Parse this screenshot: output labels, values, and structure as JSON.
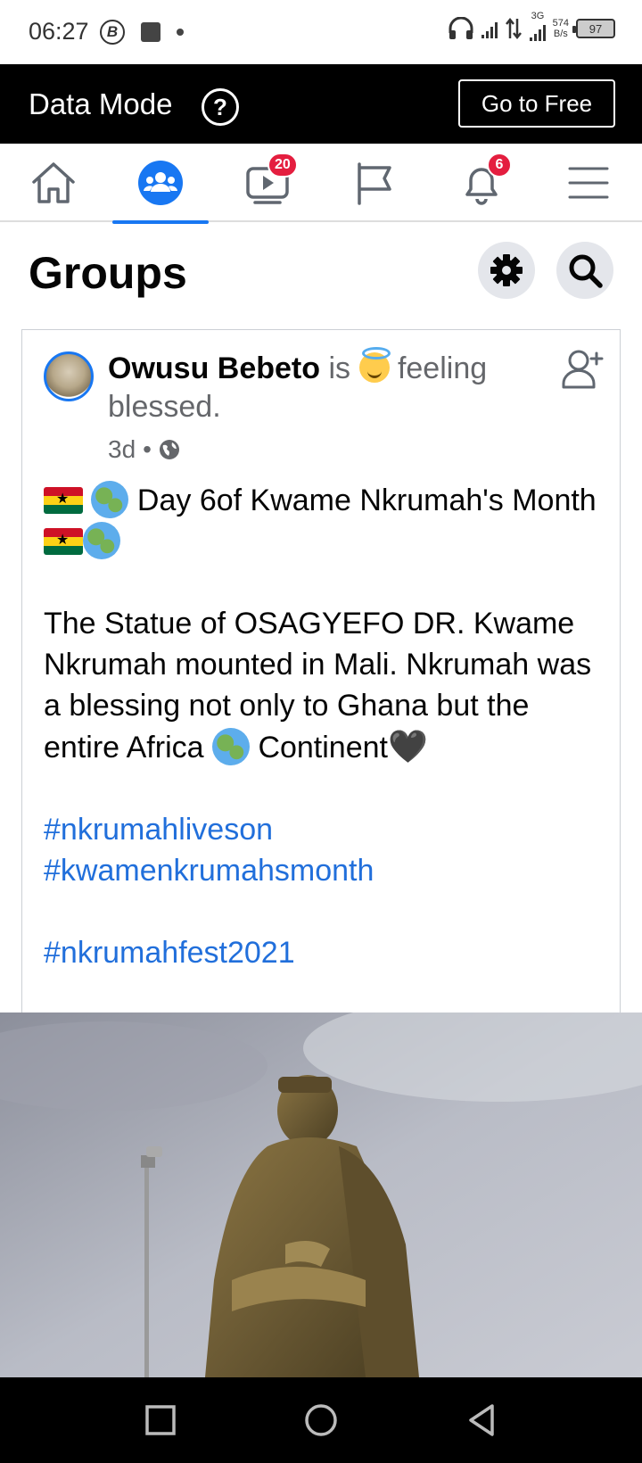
{
  "status_bar": {
    "time": "06:27",
    "network_type": "3G",
    "speed_value": "574",
    "speed_unit": "B/s",
    "battery": "97"
  },
  "data_banner": {
    "label": "Data Mode",
    "help_icon": "?",
    "go_free_label": "Go to Free"
  },
  "nav": {
    "tabs": [
      {
        "name": "home",
        "icon": "home-icon"
      },
      {
        "name": "groups",
        "icon": "groups-icon",
        "active": true
      },
      {
        "name": "watch",
        "icon": "watch-icon",
        "badge": "20"
      },
      {
        "name": "pages",
        "icon": "flag-icon"
      },
      {
        "name": "notifications",
        "icon": "bell-icon",
        "badge": "6"
      },
      {
        "name": "menu",
        "icon": "hamburger-icon"
      }
    ]
  },
  "groups": {
    "title": "Groups"
  },
  "post": {
    "author": "Owusu Bebeto",
    "is_word": "is",
    "feeling": "feeling blessed.",
    "time": "3d",
    "separator": "•",
    "line1_text": "Day 6of Kwame Nkrumah's Month",
    "paragraph2_a": "The Statue of OSAGYEFO DR. Kwame Nkrumah mounted in Mali. Nkrumah was a blessing not only to Ghana but the entire Africa",
    "paragraph2_b": "Continent",
    "heart": "🖤",
    "hashtags": [
      "#nkrumahliveson",
      "#kwamenkrumahsmonth",
      "#nkrumahfest2021"
    ]
  },
  "colors": {
    "accent": "#1877f2",
    "badge": "#e41e3f",
    "link": "#216fdb",
    "banner_bg": "#000000"
  }
}
